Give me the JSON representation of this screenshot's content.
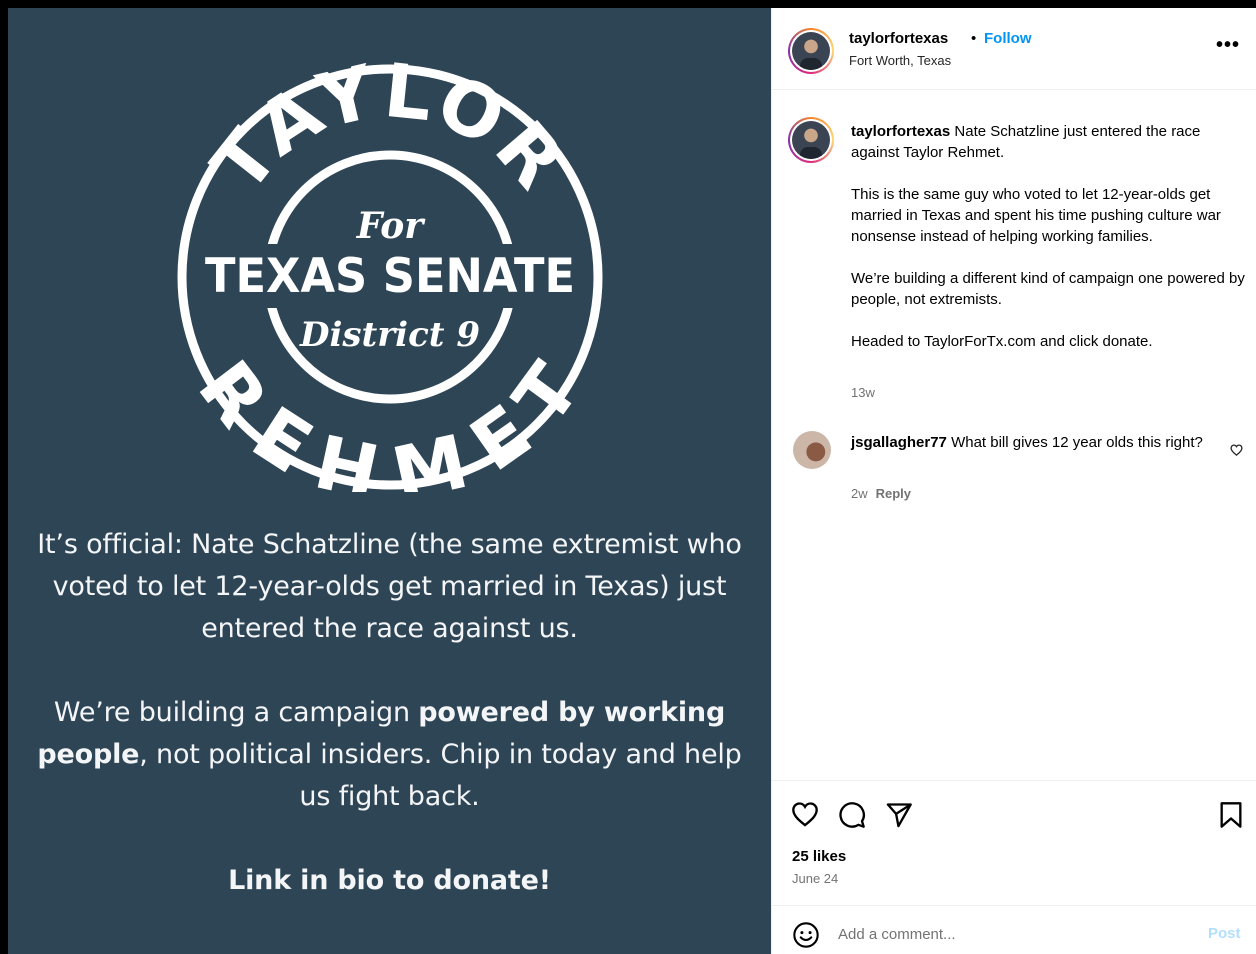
{
  "media": {
    "badge": {
      "top_arc": "TAYLOR",
      "bottom_arc": "REHMET",
      "for_text": "For",
      "main_text": "TEXAS SENATE",
      "district_text": "District 9"
    },
    "text_1": "It’s official: Nate Schatzline (the same extremist who voted to let 12-year-olds get married in Texas) just entered the race against us.",
    "text_2_pre": "We’re building a campaign ",
    "text_2_bold": "powered by working people",
    "text_2_post": ", not political insiders. Chip in today and help us fight back.",
    "text_3": "Link in bio to donate!"
  },
  "header": {
    "username": "taylorfortexas",
    "separator": "•",
    "follow_label": "Follow",
    "location": "Fort Worth, Texas",
    "more_icon": "more-horizontal-icon"
  },
  "caption": {
    "username": "taylorfortexas",
    "line1": "Nate Schatzline just entered the race against Taylor Rehmet.",
    "para2": "This is the same guy who voted to let 12-year-olds get married in Texas and spent his time pushing culture war nonsense instead of helping working families.",
    "para3": "We’re building a different kind of campaign one powered by people, not extremists.",
    "para4": "Headed to TaylorForTx.com and click donate.",
    "time": "13w"
  },
  "comment": {
    "username": "jsgallagher77",
    "text": "What bill gives 12 year olds this right?",
    "time": "2w",
    "reply_label": "Reply"
  },
  "actions": {
    "likes": "25 likes",
    "date": "June 24"
  },
  "comment_bar": {
    "placeholder": "Add a comment...",
    "post_label": "Post"
  },
  "colors": {
    "media_bg": "#2e4556",
    "link_blue": "#0095f6",
    "post_disabled": "#b2dffc"
  }
}
